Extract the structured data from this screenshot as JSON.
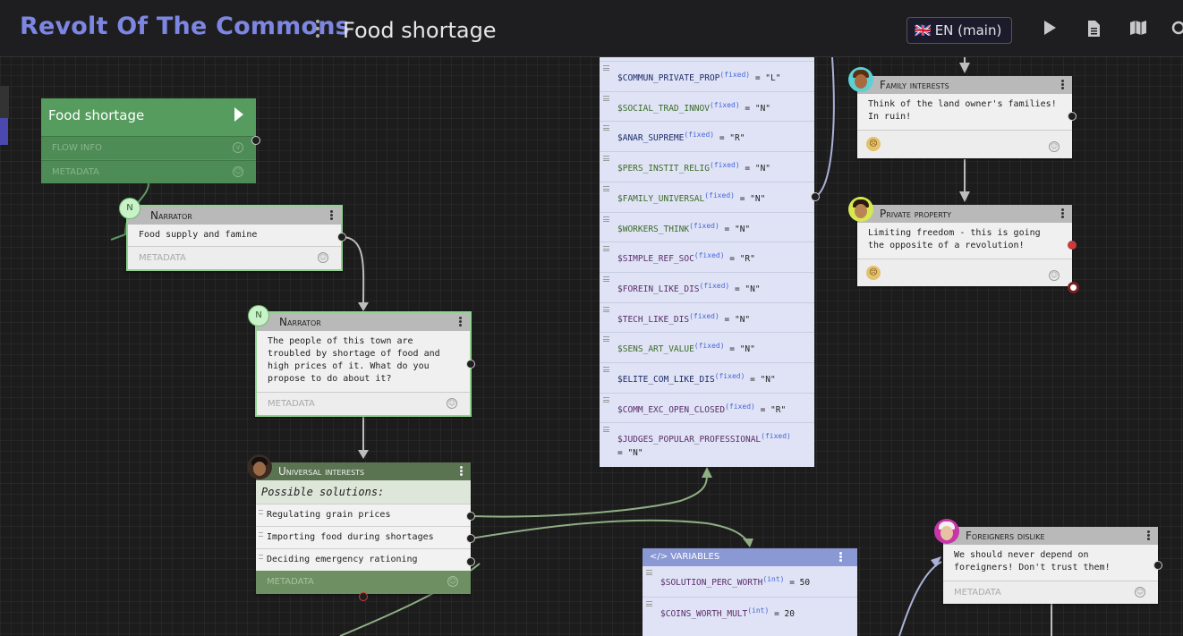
{
  "header": {
    "app_title": "Revolt Of The Commons",
    "flow_title": "Food shortage",
    "language_flag": "🇬🇧",
    "language_label": "EN (main)",
    "icons": [
      "play-icon",
      "document-icon",
      "map-icon",
      "search-icon"
    ]
  },
  "start_node": {
    "title": "Food shortage",
    "flow_info_label": "FLOW INFO",
    "metadata_label": "METADATA"
  },
  "narrator_1": {
    "badge": "N",
    "speaker": "Narrator",
    "text": "Food supply and famine",
    "metadata_label": "METADATA"
  },
  "narrator_2": {
    "badge": "N",
    "speaker": "Narrator",
    "text": "The people of this town are troubled by shortage of food and high prices of it. What do you propose to do about it?",
    "metadata_label": "METADATA"
  },
  "hub": {
    "speaker": "Universal interests",
    "prompt": "Possible solutions:",
    "options": [
      "Regulating grain prices",
      "Importing food during shortages",
      "Deciding emergency rationing"
    ],
    "metadata_label": "METADATA"
  },
  "family_node": {
    "speaker": "Family interests",
    "text": "Think of the land owner's families! In ruin!"
  },
  "private_node": {
    "speaker": "Private property",
    "text": "Limiting freedom - this is going the opposite of a revolution!"
  },
  "foreigners_node": {
    "speaker": "Foreigners dislike",
    "text": "We should never depend on foreigners! Don't trust them!",
    "metadata_label": "METADATA"
  },
  "fixed_tag": "(fixed)",
  "int_tag": "(int)",
  "variables_top": [
    {
      "name": "$COMMUN_PRIVATE_PROP",
      "value": "= \"L\"",
      "color": "#1d2b6b"
    },
    {
      "name": "$SOCIAL_TRAD_INNOV",
      "value": "= \"N\"",
      "color": "#3d6b2a"
    },
    {
      "name": "$ANAR_SUPREME",
      "value": "= \"R\"",
      "color": "#1d2b6b"
    },
    {
      "name": "$PERS_INSTIT_RELIG",
      "value": "= \"N\"",
      "color": "#3d6b2a"
    },
    {
      "name": "$FAMILY_UNIVERSAL",
      "value": "= \"N\"",
      "color": "#3d6b2a"
    },
    {
      "name": "$WORKERS_THINK",
      "value": "= \"N\"",
      "color": "#3d6b2a"
    },
    {
      "name": "$SIMPLE_REF_SOC",
      "value": "= \"R\"",
      "color": "#5b2d6b"
    },
    {
      "name": "$FOREIN_LIKE_DIS",
      "value": "= \"N\"",
      "color": "#5b2d6b"
    },
    {
      "name": "$TECH_LIKE_DIS",
      "value": "= \"N\"",
      "color": "#5b2d6b"
    },
    {
      "name": "$SENS_ART_VALUE",
      "value": "= \"N\"",
      "color": "#3d6b2a"
    },
    {
      "name": "$ELITE_COM_LIKE_DIS",
      "value": "= \"N\"",
      "color": "#1d2b6b"
    },
    {
      "name": "$COMM_EXC_OPEN_CLOSED",
      "value": "= \"R\"",
      "color": "#5b2d6b"
    },
    {
      "name": "$JUDGES_POPULAR_PROFESSIONAL",
      "value": "= \"N\"",
      "color": "#5b2d6b"
    }
  ],
  "variables_bottom": {
    "title": "VARIABLES",
    "items": [
      {
        "name": "$SOLUTION_PERC_WORTH",
        "value": "= 50"
      },
      {
        "name": "$COINS_WORTH_MULT",
        "value": "= 20"
      }
    ]
  },
  "colors": {
    "app_title": "#7d86e2",
    "start_node": "#559c5e",
    "hub_header": "#5a7451",
    "variables_panel": "#dfe3f5",
    "variables_header": "#8a98d4"
  }
}
